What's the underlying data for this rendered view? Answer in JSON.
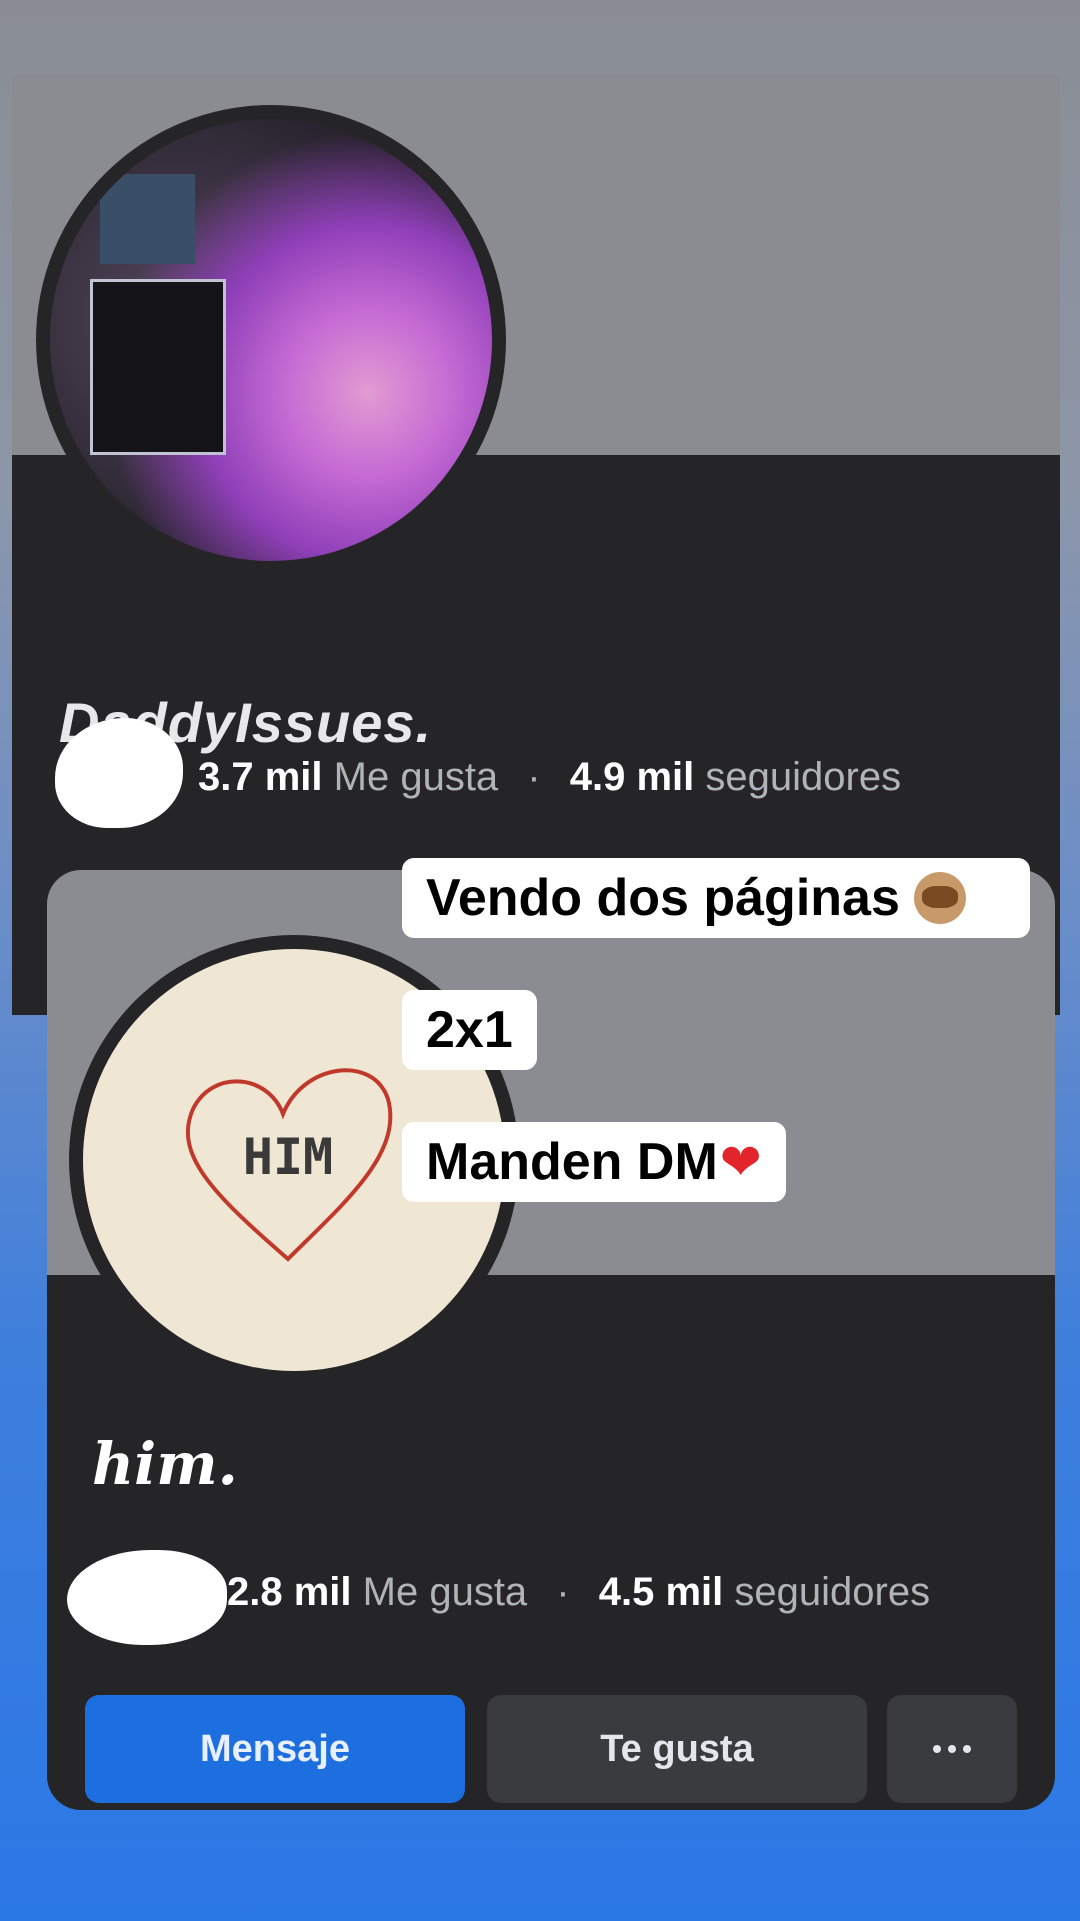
{
  "page1": {
    "name": "DaddyIssues.",
    "likes_count": "3.7 mil",
    "likes_label": "Me gusta",
    "followers_count": "4.9 mil",
    "followers_label": "seguidores"
  },
  "page2": {
    "name": "him.",
    "avatar_text": "HIM",
    "likes_count": "2.8 mil",
    "likes_label": "Me gusta",
    "followers_count": "4.5 mil",
    "followers_label": "seguidores"
  },
  "separator": "·",
  "buttons": {
    "message": "Mensaje",
    "like": "Te gusta",
    "more_icon": "more-horizontal-icon"
  },
  "captions": {
    "line1": "Vendo dos páginas",
    "line2": "2x1",
    "line3": "Manden DM",
    "line1_emoji": "see-no-evil-monkey",
    "line3_emoji": "❤"
  },
  "colors": {
    "primary_button": "#1d6fe0",
    "card_bg": "#252528",
    "cover_bg": "#8b8c91"
  }
}
